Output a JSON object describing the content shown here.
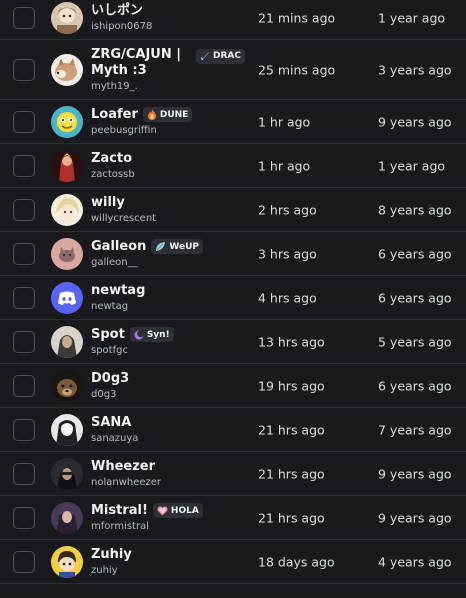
{
  "members": [
    {
      "display_name": "いしポン",
      "username": "ishipon0678",
      "member_since": "21 mins ago",
      "joined_discord": "1 year ago",
      "avatar_icon": "anime-avatar-icon",
      "avatar_color": "#d6c7b0"
    },
    {
      "display_name": "ZRG/CAJUN | Myth :3",
      "username": "myth19_.",
      "member_since": "25 mins ago",
      "joined_discord": "3 years ago",
      "avatar_icon": "fox-avatar-icon",
      "avatar_color": "#caa07a",
      "tag": {
        "label": "DRAC",
        "icon": "sword-icon",
        "color": "#8a7cf0"
      }
    },
    {
      "display_name": "Loafer",
      "username": "peebusgriffin",
      "member_since": "1 hr ago",
      "joined_discord": "9 years ago",
      "avatar_icon": "cartoon-avatar-icon",
      "avatar_color": "#4db3c9",
      "tag": {
        "label": "DUNE",
        "icon": "flame-icon",
        "color": "#f07a2a"
      }
    },
    {
      "display_name": "Zacto",
      "username": "zactossb",
      "member_since": "1 hr ago",
      "joined_discord": "1 year ago",
      "avatar_icon": "character-avatar-icon",
      "avatar_color": "#b0302a"
    },
    {
      "display_name": "willy",
      "username": "willycrescent",
      "member_since": "2 hrs ago",
      "joined_discord": "8 years ago",
      "avatar_icon": "anime-avatar-icon",
      "avatar_color": "#e6d39a"
    },
    {
      "display_name": "Galleon",
      "username": "galleon__",
      "member_since": "3 hrs ago",
      "joined_discord": "6 years ago",
      "avatar_icon": "cat-avatar-icon",
      "avatar_color": "#d9a6a0",
      "tag": {
        "label": "WeUP",
        "icon": "leaf-icon",
        "color": "#9fd0e0"
      }
    },
    {
      "display_name": "newtag",
      "username": "newtag",
      "member_since": "4 hrs ago",
      "joined_discord": "6 years ago",
      "avatar_icon": "discord-logo-icon",
      "avatar_color": "#5865f2"
    },
    {
      "display_name": "Spot",
      "username": "spotfgc",
      "member_since": "13 hrs ago",
      "joined_discord": "5 years ago",
      "avatar_icon": "dark-character-avatar-icon",
      "avatar_color": "#3a3a3a",
      "tag": {
        "label": "Syn!",
        "icon": "moon-icon",
        "color": "#b07cf0"
      }
    },
    {
      "display_name": "D0g3",
      "username": "d0g3",
      "member_since": "19 hrs ago",
      "joined_discord": "6 years ago",
      "avatar_icon": "dog-avatar-icon",
      "avatar_color": "#7a5a3a"
    },
    {
      "display_name": "SANA",
      "username": "sanazuya",
      "member_since": "21 hrs ago",
      "joined_discord": "7 years ago",
      "avatar_icon": "manga-avatar-icon",
      "avatar_color": "#e8e8e8"
    },
    {
      "display_name": "Wheezer",
      "username": "nolanwheezer",
      "member_since": "21 hrs ago",
      "joined_discord": "9 years ago",
      "avatar_icon": "dark-character-avatar-icon",
      "avatar_color": "#2a2a30"
    },
    {
      "display_name": "Mistral!",
      "username": "mformistral",
      "member_since": "21 hrs ago",
      "joined_discord": "9 years ago",
      "avatar_icon": "character-avatar-icon",
      "avatar_color": "#4a3a5a",
      "tag": {
        "label": "HOLA",
        "icon": "heart-icon",
        "color": "#f08aa0"
      }
    },
    {
      "display_name": "Zuhiy",
      "username": "zuhiy",
      "member_since": "18 days ago",
      "joined_discord": "4 years ago",
      "avatar_icon": "cartoon-avatar-icon",
      "avatar_color": "#f0d040"
    }
  ]
}
